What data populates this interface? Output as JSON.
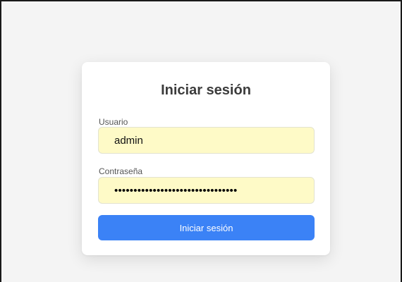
{
  "login": {
    "title": "Iniciar sesión",
    "username": {
      "label": "Usuario",
      "value": "admin"
    },
    "password": {
      "label": "Contraseña",
      "value": "admin-password-masked-0123456789"
    },
    "submit_label": "Iniciar sesión"
  },
  "colors": {
    "page_background": "#f4f4f4",
    "card_background": "#ffffff",
    "autofill_background": "#fefac7",
    "primary_button": "#3b82f6"
  }
}
